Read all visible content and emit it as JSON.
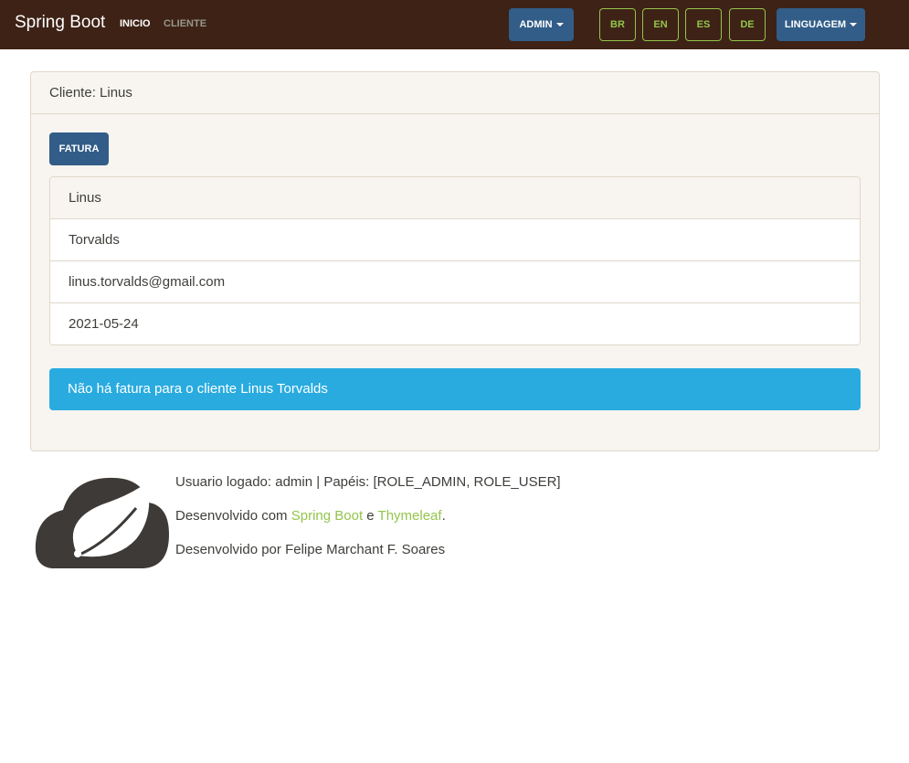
{
  "navbar": {
    "brand": "Spring Boot",
    "links": [
      "INICIO",
      "CLIENTE"
    ],
    "admin_label": "ADMIN",
    "languages": [
      "BR",
      "EN",
      "ES",
      "DE"
    ],
    "language_menu_label": "LINGUAGEM"
  },
  "card": {
    "header": "Cliente: Linus",
    "button_label": "FATURA",
    "details": [
      "Linus",
      "Torvalds",
      "linus.torvalds@gmail.com",
      "2021-05-24"
    ],
    "alert": "Não há fatura para o cliente Linus Torvalds"
  },
  "footer": {
    "logged_user": "Usuario logado: admin | Papéis: [ROLE_ADMIN, ROLE_USER]",
    "developed_with_prefix": "Desenvolvido com ",
    "spring_boot_link": "Spring Boot",
    "conjunction": " e ",
    "thymeleaf_link": "Thymeleaf",
    "period": ".",
    "developed_by": "Desenvolvido por Felipe Marchant F. Soares"
  },
  "colors": {
    "navbar": "#3e2216",
    "primary": "#325d88",
    "success": "#93c54b",
    "info": "#29abe0",
    "card_bg": "#f8f5f0"
  },
  "icons": [
    "caret-down-icon",
    "spring-leaf-logo"
  ]
}
